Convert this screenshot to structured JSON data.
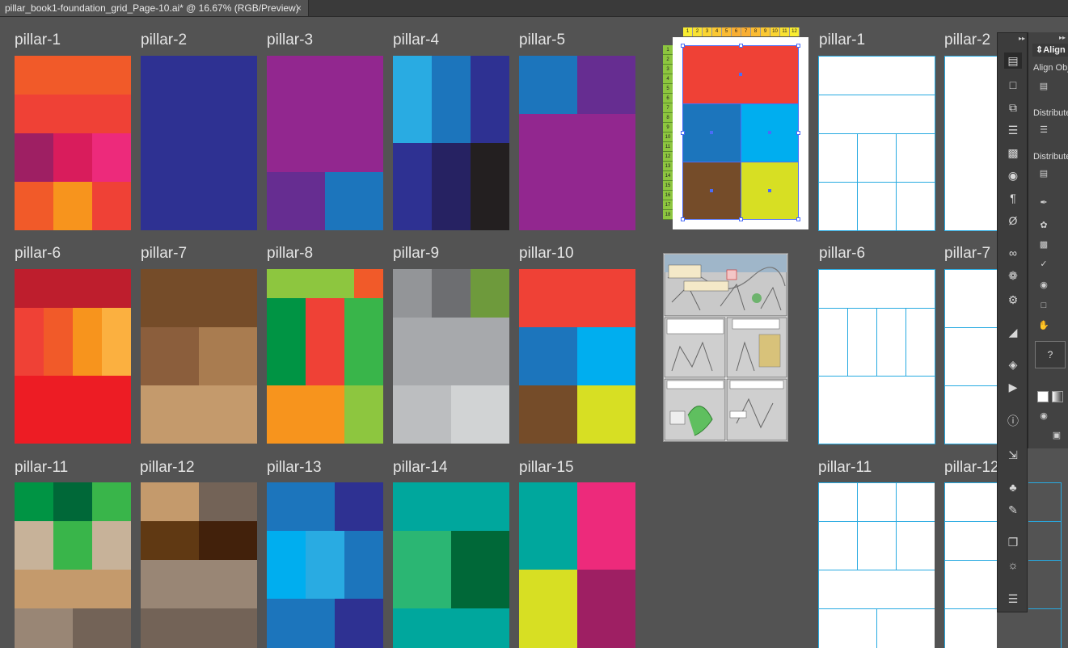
{
  "tab": {
    "title": "pillar_book1-foundation_grid_Page-10.ai* @ 16.67% (RGB/Preview)",
    "close": "×"
  },
  "artboards": [
    {
      "label": "pillar-1"
    },
    {
      "label": "pillar-2"
    },
    {
      "label": "pillar-3"
    },
    {
      "label": "pillar-4"
    },
    {
      "label": "pillar-5"
    },
    {
      "label": "pillar-6"
    },
    {
      "label": "pillar-7"
    },
    {
      "label": "pillar-8"
    },
    {
      "label": "pillar-9"
    },
    {
      "label": "pillar-10"
    },
    {
      "label": "pillar-11"
    },
    {
      "label": "pillar-12"
    },
    {
      "label": "pillar-13"
    },
    {
      "label": "pillar-14"
    },
    {
      "label": "pillar-15"
    }
  ],
  "outline_artboards": [
    {
      "label": "pillar-1"
    },
    {
      "label": "pillar-2"
    },
    {
      "label": "pillar-6"
    },
    {
      "label": "pillar-7"
    },
    {
      "label": "pillar-11"
    },
    {
      "label": "pillar-12"
    }
  ],
  "ruler": {
    "columns": [
      "1",
      "2",
      "3",
      "4",
      "5",
      "6",
      "7",
      "8",
      "9",
      "10",
      "11",
      "12"
    ],
    "rows": [
      "1",
      "2",
      "3",
      "4",
      "5",
      "6",
      "7",
      "8",
      "9",
      "10",
      "11",
      "12",
      "13",
      "14",
      "15",
      "16",
      "17",
      "18"
    ]
  },
  "colors": {
    "canvas": "#535353",
    "accent_outline": "#27aae1",
    "selection": "#4a6cf7"
  },
  "align_panel": {
    "tab_label": "Align",
    "align_objects": "Align Obje",
    "distribute_objects": "Distribute",
    "distribute_spacing": "Distribute"
  },
  "tools": [
    "align-icon",
    "artboard-icon",
    "transform-icon",
    "stroke-icon",
    "gradient-icon",
    "pathfinder-icon",
    "paragraph-icon",
    "opentype-icon",
    "links-icon",
    "symbols-icon",
    "actions-icon",
    "appearance-icon",
    "navigator-icon",
    "play-icon",
    "info-icon",
    "export-icon",
    "club-icon",
    "brush-icon",
    "layers-stack-icon",
    "globe-icon",
    "layers-icon"
  ],
  "color_swatch": {
    "placeholder": "?"
  }
}
